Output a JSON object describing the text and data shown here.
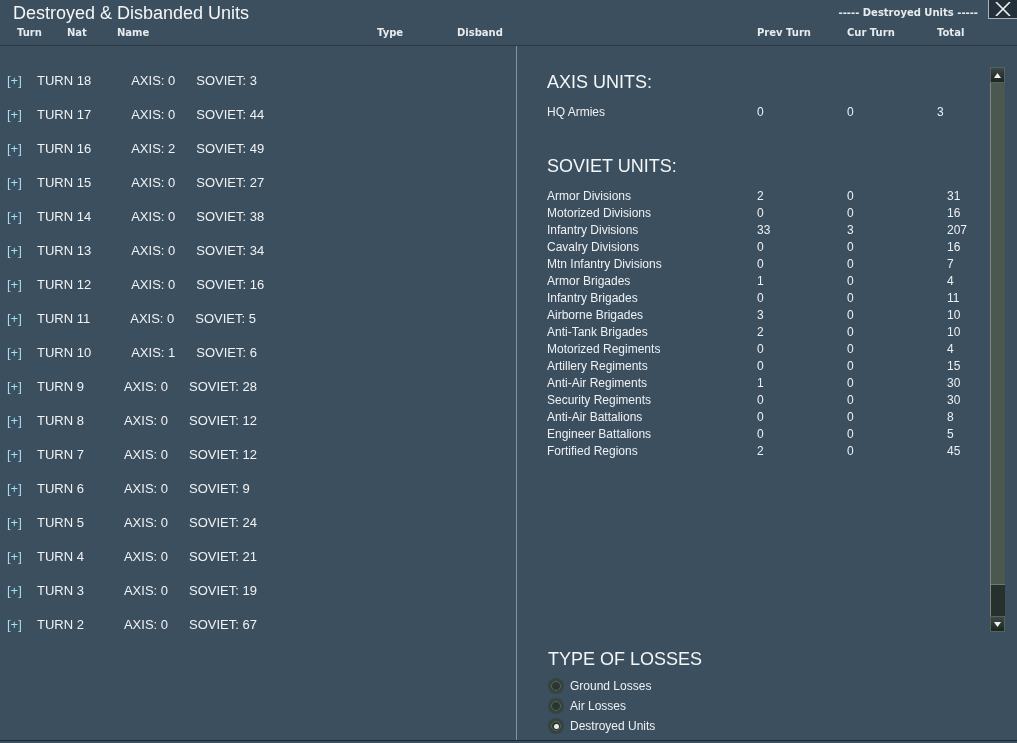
{
  "window": {
    "title": "Destroyed & Disbanded Units",
    "caption": "----- Destroyed Units -----"
  },
  "list_columns": [
    "Turn",
    "Nat",
    "Name",
    "Type",
    "Disband"
  ],
  "summary_columns": [
    "Prev Turn",
    "Cur Turn",
    "Total"
  ],
  "turns": [
    {
      "toggle": "[+]",
      "turn": "TURN 18",
      "axis": "AXIS: 0",
      "soviet": "SOVIET: 3"
    },
    {
      "toggle": "[+]",
      "turn": "TURN 17",
      "axis": "AXIS: 0",
      "soviet": "SOVIET: 44"
    },
    {
      "toggle": "[+]",
      "turn": "TURN 16",
      "axis": "AXIS: 2",
      "soviet": "SOVIET: 49"
    },
    {
      "toggle": "[+]",
      "turn": "TURN 15",
      "axis": "AXIS: 0",
      "soviet": "SOVIET: 27"
    },
    {
      "toggle": "[+]",
      "turn": "TURN 14",
      "axis": "AXIS: 0",
      "soviet": "SOVIET: 38"
    },
    {
      "toggle": "[+]",
      "turn": "TURN 13",
      "axis": "AXIS: 0",
      "soviet": "SOVIET: 34"
    },
    {
      "toggle": "[+]",
      "turn": "TURN 12",
      "axis": "AXIS: 0",
      "soviet": "SOVIET: 16"
    },
    {
      "toggle": "[+]",
      "turn": "TURN 11",
      "axis": "AXIS: 0",
      "soviet": "SOVIET: 5"
    },
    {
      "toggle": "[+]",
      "turn": "TURN 10",
      "axis": "AXIS: 1",
      "soviet": "SOVIET: 6"
    },
    {
      "toggle": "[+]",
      "turn": "TURN 9",
      "axis": "AXIS: 0",
      "soviet": "SOVIET: 28"
    },
    {
      "toggle": "[+]",
      "turn": "TURN 8",
      "axis": "AXIS: 0",
      "soviet": "SOVIET: 12"
    },
    {
      "toggle": "[+]",
      "turn": "TURN 7",
      "axis": "AXIS: 0",
      "soviet": "SOVIET: 12"
    },
    {
      "toggle": "[+]",
      "turn": "TURN 6",
      "axis": "AXIS: 0",
      "soviet": "SOVIET: 9"
    },
    {
      "toggle": "[+]",
      "turn": "TURN 5",
      "axis": "AXIS: 0",
      "soviet": "SOVIET: 24"
    },
    {
      "toggle": "[+]",
      "turn": "TURN 4",
      "axis": "AXIS: 0",
      "soviet": "SOVIET: 21"
    },
    {
      "toggle": "[+]",
      "turn": "TURN 3",
      "axis": "AXIS: 0",
      "soviet": "SOVIET: 19"
    },
    {
      "toggle": "[+]",
      "turn": "TURN 2",
      "axis": "AXIS: 0",
      "soviet": "SOVIET: 67"
    }
  ],
  "sections": [
    {
      "heading": "AXIS UNITS:",
      "rows": [
        {
          "name": "HQ Armies",
          "prev_turn": "0",
          "cur_turn": "0",
          "total": "3"
        }
      ]
    },
    {
      "heading": "SOVIET UNITS:",
      "rows": [
        {
          "name": "Armor Divisions",
          "prev_turn": "2",
          "cur_turn": "0",
          "total": "31"
        },
        {
          "name": "Motorized Divisions",
          "prev_turn": "0",
          "cur_turn": "0",
          "total": "16"
        },
        {
          "name": "Infantry Divisions",
          "prev_turn": "33",
          "cur_turn": "3",
          "total": "207"
        },
        {
          "name": "Cavalry Divisions",
          "prev_turn": "0",
          "cur_turn": "0",
          "total": "16"
        },
        {
          "name": "Mtn Infantry Divisions",
          "prev_turn": "0",
          "cur_turn": "0",
          "total": "7"
        },
        {
          "name": "Armor Brigades",
          "prev_turn": "1",
          "cur_turn": "0",
          "total": "4"
        },
        {
          "name": "Infantry Brigades",
          "prev_turn": "0",
          "cur_turn": "0",
          "total": "11"
        },
        {
          "name": "Airborne Brigades",
          "prev_turn": "3",
          "cur_turn": "0",
          "total": "10"
        },
        {
          "name": "Anti-Tank Brigades",
          "prev_turn": "2",
          "cur_turn": "0",
          "total": "10"
        },
        {
          "name": "Motorized Regiments",
          "prev_turn": "0",
          "cur_turn": "0",
          "total": "4"
        },
        {
          "name": "Artillery Regiments",
          "prev_turn": "0",
          "cur_turn": "0",
          "total": "15"
        },
        {
          "name": "Anti-Air Regiments",
          "prev_turn": "1",
          "cur_turn": "0",
          "total": "30"
        },
        {
          "name": "Security Regiments",
          "prev_turn": "0",
          "cur_turn": "0",
          "total": "30"
        },
        {
          "name": "Anti-Air Battalions",
          "prev_turn": "0",
          "cur_turn": "0",
          "total": "8"
        },
        {
          "name": "Engineer Battalions",
          "prev_turn": "0",
          "cur_turn": "0",
          "total": "5"
        },
        {
          "name": "Fortified Regions",
          "prev_turn": "2",
          "cur_turn": "0",
          "total": "45"
        }
      ]
    }
  ],
  "type_of_losses": {
    "heading": "TYPE OF LOSSES",
    "options": [
      {
        "label": "Ground Losses",
        "selected": false
      },
      {
        "label": "Air Losses",
        "selected": false
      },
      {
        "label": "Destroyed Units",
        "selected": true
      }
    ]
  }
}
